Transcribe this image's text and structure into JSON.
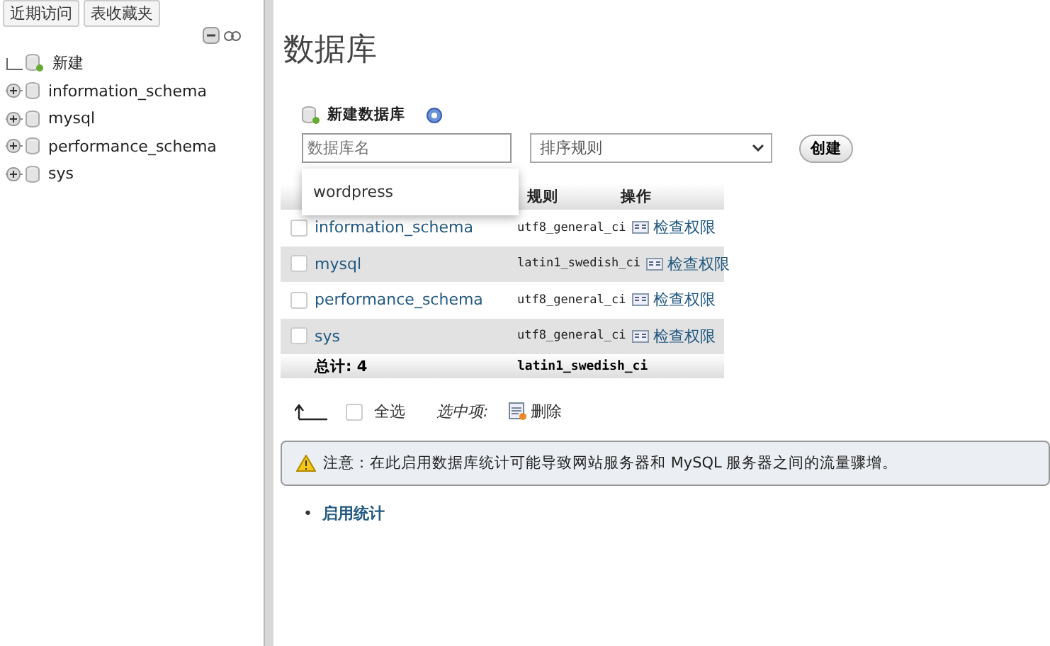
{
  "sidebar": {
    "tabs": [
      {
        "label": "近期访问"
      },
      {
        "label": "表收藏夹"
      }
    ],
    "tree": [
      {
        "label": "新建",
        "kind": "new"
      },
      {
        "label": "information_schema",
        "kind": "db"
      },
      {
        "label": "mysql",
        "kind": "db"
      },
      {
        "label": "performance_schema",
        "kind": "db"
      },
      {
        "label": "sys",
        "kind": "db"
      }
    ]
  },
  "main": {
    "title": "数据库",
    "create": {
      "heading": "新建数据库",
      "name_placeholder": "数据库名",
      "collation_placeholder": "排序规则",
      "button": "创建",
      "suggestions": [
        "wordpress"
      ]
    },
    "table": {
      "columns": [
        "规则",
        "操作"
      ],
      "rows": [
        {
          "name": "information_schema",
          "collation": "utf8_general_ci",
          "action": "检查权限",
          "checked": false
        },
        {
          "name": "mysql",
          "collation": "latin1_swedish_ci",
          "action": "检查权限",
          "checked": false
        },
        {
          "name": "performance_schema",
          "collation": "utf8_general_ci",
          "action": "检查权限",
          "checked": false
        },
        {
          "name": "sys",
          "collation": "utf8_general_ci",
          "action": "检查权限",
          "checked": false
        }
      ],
      "total_label": "总计: 4",
      "total_collation": "latin1_swedish_ci"
    },
    "bulk": {
      "select_all": "全选",
      "select_all_checked": false,
      "with_selected": "选中项:",
      "delete": "删除"
    },
    "notice": "注意：在此启用数据库统计可能导致网站服务器和 MySQL 服务器之间的流量骤增。",
    "links": [
      {
        "bullet": "•",
        "label": "启用统计"
      }
    ]
  }
}
